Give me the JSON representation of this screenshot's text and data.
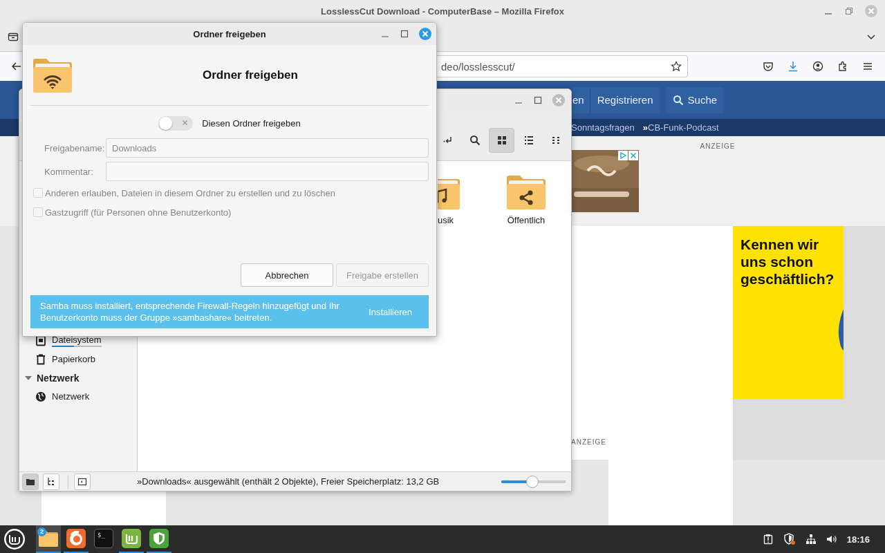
{
  "browser": {
    "title": "LosslessCut Download - ComputerBase – Mozilla Firefox",
    "url": "deo/losslesscut/",
    "site_nav": [
      "en",
      "Registrieren",
      "Suche"
    ],
    "sub_nav": [
      "Sonntagsfragen",
      "**»**CB-Funk-Podcast"
    ],
    "ad_labels": [
      "ANZEIGE",
      "ANZEIGE"
    ],
    "ad_headline": "Kennen wir uns schon geschäftlich?"
  },
  "file_manager": {
    "toolbar": [
      {
        "kind": "return",
        "selected": false
      },
      {
        "kind": "search",
        "selected": false
      },
      {
        "kind": "grid",
        "selected": true
      },
      {
        "kind": "list",
        "selected": false
      },
      {
        "kind": "compact",
        "selected": false
      }
    ],
    "sidebar": [
      {
        "kind": "drive",
        "label": "Dateisystem",
        "level": 0.45
      },
      {
        "kind": "trash",
        "label": "Papierkorb"
      },
      {
        "kind": "header",
        "label": "Netzwerk",
        "expanded": true
      },
      {
        "kind": "globe",
        "label": "Netzwerk"
      }
    ],
    "files": [
      {
        "kind": "music",
        "label": "usik",
        "partly_hidden": true
      },
      {
        "kind": "shared",
        "label": "Öffentlich",
        "partly_hidden": false
      }
    ],
    "status_buttons": [
      {
        "kind": "places",
        "selected": true
      },
      {
        "kind": "tree",
        "selected": false
      },
      {
        "kind": "sidebar",
        "selected": false
      }
    ],
    "status": "»Downloads« ausgewählt (enthält 2 Objekte), Freier Speicherplatz: 13,2 GB",
    "zoom": {
      "level": 0.48
    }
  },
  "dialog": {
    "title": "Ordner freigeben",
    "heading": "Ordner freigeben",
    "share_toggle": {
      "label": "Diesen Ordner freigeben",
      "on": false
    },
    "fields": [
      {
        "label": "Freigabename:",
        "value": "Downloads",
        "disabled": true
      },
      {
        "label": "Kommentar:",
        "disabled": true
      }
    ],
    "options": [
      {
        "label": "Anderen erlauben, Dateien in diesem Ordner zu erstellen und zu löschen",
        "checked": false,
        "disabled": true
      },
      {
        "label": "Gastzugriff (für Personen ohne Benutzerkonto)",
        "checked": false,
        "disabled": true
      }
    ],
    "buttons": [
      {
        "label": "Abbrechen",
        "disabled": false
      },
      {
        "label": "Freigabe erstellen",
        "disabled": true
      }
    ],
    "info": {
      "text": "Samba muss installiert, entsprechende Firewall-Regeln hinzugefügt und Ihr Benutzerkonto muss der Gruppe »sambashare« beitreten.",
      "action": "Installieren"
    }
  },
  "taskbar": {
    "apps": [
      {
        "kind": "files",
        "badge": "2",
        "selected": true,
        "running": true
      },
      {
        "kind": "firefox",
        "selected": false,
        "running": true
      },
      {
        "kind": "terminal",
        "label": "$_",
        "selected": false,
        "running": false
      },
      {
        "kind": "update",
        "selected": false,
        "running": true
      },
      {
        "kind": "shield",
        "selected": false,
        "running": true
      }
    ],
    "clock": "18:16"
  }
}
